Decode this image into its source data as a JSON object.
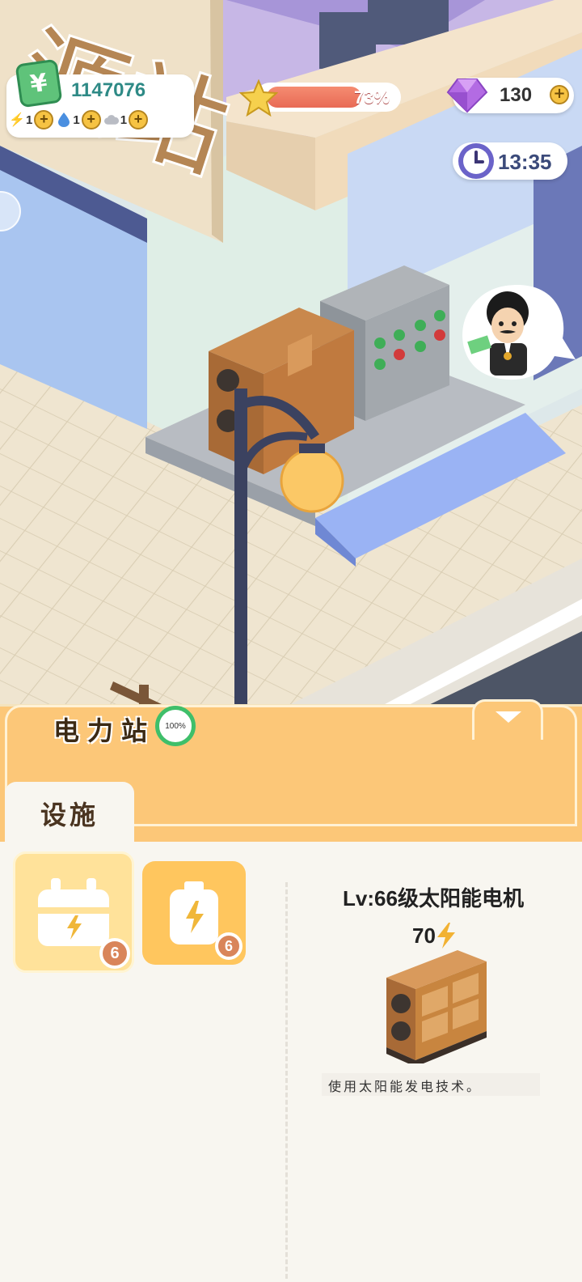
{
  "hud": {
    "money": "1147076",
    "money_icon": "¥",
    "resources": [
      {
        "icon": "lightning-icon",
        "count": "1"
      },
      {
        "icon": "water-drop-icon",
        "count": "1"
      },
      {
        "icon": "cloud-icon",
        "count": "1"
      }
    ],
    "plus": "+",
    "level_progress_pct": 73,
    "level_progress_text": "73%",
    "gems": "130",
    "timer": "13:35"
  },
  "panel": {
    "station_name": "电力站",
    "station_pct": "100%",
    "tab_label": "设施",
    "categories": [
      {
        "icon": "generator-icon",
        "badge": "6",
        "selected": true
      },
      {
        "icon": "battery-icon",
        "badge": "6",
        "selected": false
      }
    ],
    "detail": {
      "title": "Lv:66级太阳能电机",
      "power": "70",
      "power_icon": "lightning-icon",
      "description": "使用太阳能发电技术。"
    }
  },
  "colors": {
    "panel_orange": "#fcc778",
    "progress_red": "#e86a55",
    "money_green": "#2e8a86",
    "gem_purple": "#b36be3"
  }
}
